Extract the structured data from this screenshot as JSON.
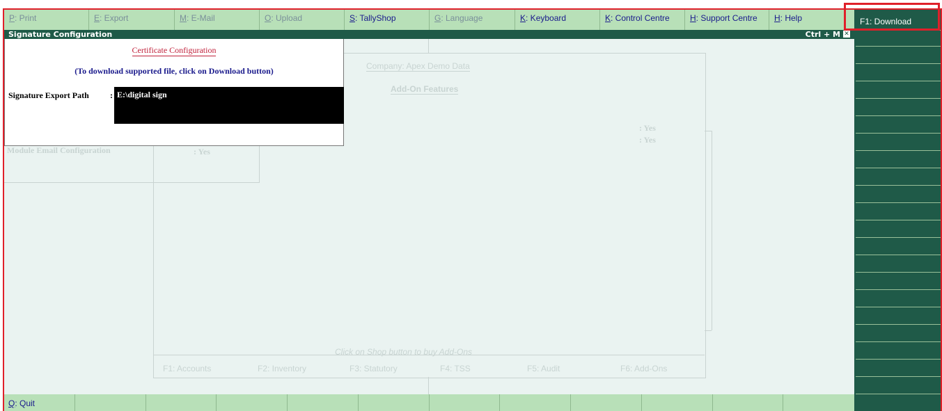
{
  "topbar": {
    "items": [
      {
        "key": "P",
        "label": ": Print",
        "dim": true
      },
      {
        "key": "E",
        "label": ": Export",
        "dim": true
      },
      {
        "key": "M",
        "label": ": E-Mail",
        "dim": true
      },
      {
        "key": "O",
        "label": ": Upload",
        "dim": true
      },
      {
        "key": "S",
        "label": ": TallyShop",
        "dim": false
      },
      {
        "key": "G",
        "label": ": Language",
        "dim": true
      },
      {
        "key": "K",
        "label": ": Keyboard",
        "dim": false
      },
      {
        "key": "K",
        "label": ": Control Centre",
        "dim": false
      },
      {
        "key": "H",
        "label": ": Support Centre",
        "dim": false
      },
      {
        "key": "H",
        "label": ": Help",
        "dim": false
      }
    ]
  },
  "titlebar": {
    "title": "Signature Configuration",
    "shortcut": "Ctrl + M",
    "close_glyph": "✕"
  },
  "popup": {
    "heading": "Certificate Configuration",
    "note": "(To download supported file, click on Download button)",
    "field_label": "Signature Export Path",
    "field_colon": ":",
    "field_value": "E:\\digital sign"
  },
  "background": {
    "company": "Company:  Apex Demo Data",
    "addon_title": "Add-On Features",
    "yes1": ": Yes",
    "yes2": ": Yes",
    "module_email": "Module Email Configuration",
    "module_email_value": ":  Yes",
    "shop_hint": "Click on Shop button to buy Add-Ons",
    "tabs": [
      "F1:  Accounts",
      "F2:  Inventory",
      "F3:  Statutory",
      "F4:  TSS",
      "F5:  Audit",
      "F6:  Add-Ons"
    ]
  },
  "bottombar": {
    "quit_key": "Q",
    "quit_label": ": Quit"
  },
  "rightpanel": {
    "download_label": "F1: Download"
  },
  "colors": {
    "accent_red": "#e0202a",
    "panel_green": "#1f5a48",
    "bar_green": "#b8e0b8"
  }
}
